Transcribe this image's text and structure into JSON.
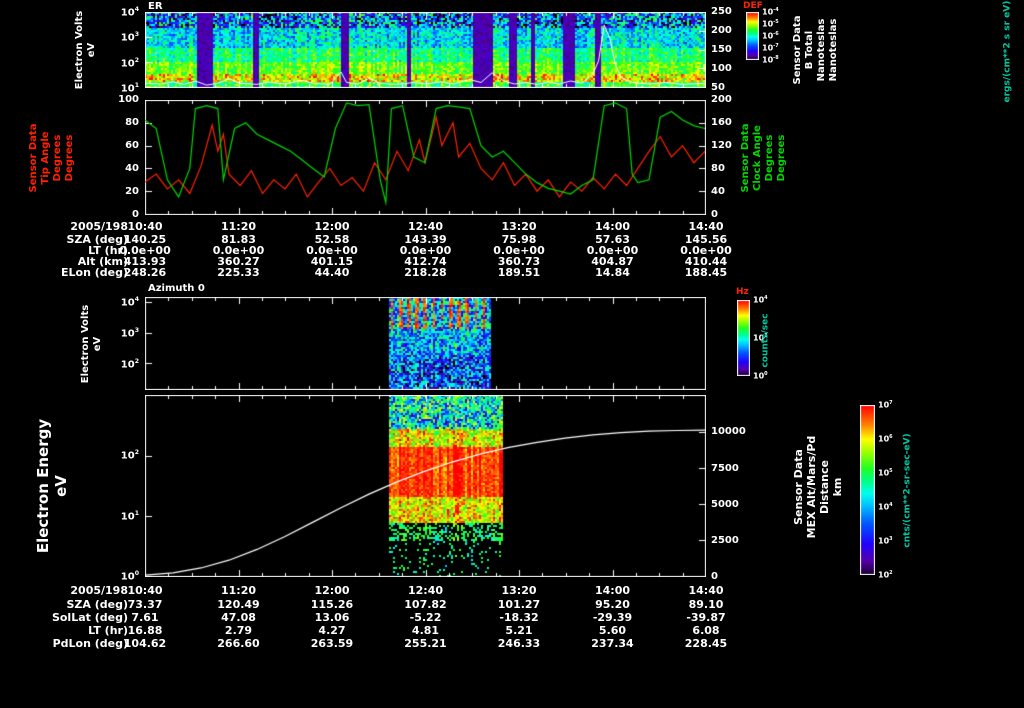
{
  "figure": {
    "background": "#000000"
  },
  "colors": {
    "white": "#ffffff",
    "red": "#ff2200",
    "green": "#00d800",
    "teal": "#00c8a0",
    "background": "#000000"
  },
  "colormap": [
    [
      0.0,
      "#1a0033"
    ],
    [
      0.08,
      "#5500aa"
    ],
    [
      0.18,
      "#2200ff"
    ],
    [
      0.3,
      "#0055ff"
    ],
    [
      0.4,
      "#00bbff"
    ],
    [
      0.48,
      "#00ffee"
    ],
    [
      0.55,
      "#00ff88"
    ],
    [
      0.63,
      "#22ff22"
    ],
    [
      0.72,
      "#99ff00"
    ],
    [
      0.8,
      "#ffff00"
    ],
    [
      0.88,
      "#ff8800"
    ],
    [
      1.0,
      "#ff0000"
    ]
  ],
  "time_axis": {
    "date": "2005/198",
    "ticks": [
      "10:40",
      "11:20",
      "12:00",
      "12:40",
      "13:20",
      "14:00",
      "14:40"
    ]
  },
  "chart_data": [
    {
      "id": "panel1",
      "type": "heatmap",
      "title": "ER",
      "ylabel_lines": [
        "Electron Volts",
        "eV"
      ],
      "yticks": [
        "10^4",
        "10^3",
        "10^2",
        "10^1"
      ],
      "y_range_log": [
        "10^1",
        "10^4"
      ],
      "x_range": [
        "10:40",
        "14:40"
      ],
      "right_axis": {
        "label_lines": [
          "Sensor Data",
          "B Total",
          "Nanoteslas",
          "Nanoteslas"
        ],
        "ticks": [
          "250",
          "200",
          "150",
          "100",
          "50"
        ],
        "range": [
          50,
          250
        ]
      },
      "colorbar": {
        "title": "DEF",
        "ticks": [
          "10^-4",
          "10^-5",
          "10^-6",
          "10^-7",
          "10^-8"
        ],
        "unit": "ergs/(cm**2 s sr eV)"
      },
      "white_line": {
        "axis": "right",
        "x": [
          0,
          0.03,
          0.05,
          0.07,
          0.09,
          0.11,
          0.13,
          0.15,
          0.17,
          0.2,
          0.22,
          0.25,
          0.28,
          0.3,
          0.33,
          0.35,
          0.36,
          0.38,
          0.4,
          0.42,
          0.45,
          0.48,
          0.5,
          0.53,
          0.55,
          0.58,
          0.6,
          0.62,
          0.64,
          0.66,
          0.68,
          0.7,
          0.72,
          0.74,
          0.76,
          0.78,
          0.8,
          0.81,
          0.82,
          0.83,
          0.84,
          0.85,
          0.87,
          0.9,
          0.93,
          0.96,
          1.0
        ],
        "y": [
          60,
          58,
          64,
          57,
          66,
          55,
          60,
          72,
          60,
          57,
          63,
          58,
          68,
          60,
          57,
          90,
          62,
          58,
          73,
          60,
          57,
          62,
          58,
          64,
          58,
          70,
          62,
          88,
          66,
          58,
          62,
          57,
          63,
          58,
          66,
          60,
          85,
          120,
          215,
          180,
          110,
          75,
          62,
          58,
          62,
          57,
          60
        ]
      },
      "texture": {
        "extent": [
          0,
          1
        ],
        "bands": [
          {
            "from": 0.0,
            "to": 0.2,
            "level": 0.3,
            "noise": 0.35
          },
          {
            "from": 0.2,
            "to": 0.45,
            "level": 0.45,
            "noise": 0.15
          },
          {
            "from": 0.45,
            "to": 0.65,
            "level": 0.57,
            "noise": 0.12
          },
          {
            "from": 0.65,
            "to": 0.8,
            "level": 0.68,
            "noise": 0.1
          },
          {
            "from": 0.8,
            "to": 0.9,
            "level": 0.8,
            "noise": 0.16
          },
          {
            "from": 0.9,
            "to": 1.01,
            "level": 0.62,
            "noise": 0.12
          }
        ],
        "streaks": [
          {
            "x": 0.105,
            "w": 0.03
          },
          {
            "x": 0.195,
            "w": 0.01
          },
          {
            "x": 0.355,
            "w": 0.014
          },
          {
            "x": 0.47,
            "w": 0.008
          },
          {
            "x": 0.6,
            "w": 0.034
          },
          {
            "x": 0.655,
            "w": 0.014
          },
          {
            "x": 0.69,
            "w": 0.01
          },
          {
            "x": 0.755,
            "w": 0.022
          },
          {
            "x": 0.806,
            "w": 0.01
          }
        ]
      }
    },
    {
      "id": "panel2",
      "type": "line",
      "x_range": [
        "10:40",
        "14:40"
      ],
      "left_axis": {
        "label_lines": [
          "Sensor Data",
          "Tip Angle",
          "Degrees",
          "Degrees"
        ],
        "ticks": [
          "100",
          "80",
          "60",
          "40",
          "20",
          "0"
        ],
        "range": [
          0,
          100
        ]
      },
      "right_axis": {
        "label_lines": [
          "Sensor Data",
          "Clock Angle",
          "Degrees",
          "Degrees"
        ],
        "ticks": [
          "200",
          "160",
          "120",
          "80",
          "40",
          "0"
        ],
        "range": [
          0,
          200
        ]
      },
      "series": [
        {
          "name": "tip_angle",
          "axis": "left",
          "x": [
            0,
            0.02,
            0.04,
            0.06,
            0.08,
            0.1,
            0.12,
            0.13,
            0.14,
            0.15,
            0.17,
            0.19,
            0.21,
            0.23,
            0.25,
            0.27,
            0.29,
            0.31,
            0.33,
            0.35,
            0.37,
            0.39,
            0.41,
            0.43,
            0.45,
            0.47,
            0.49,
            0.5,
            0.52,
            0.53,
            0.55,
            0.56,
            0.58,
            0.6,
            0.62,
            0.64,
            0.66,
            0.68,
            0.7,
            0.72,
            0.74,
            0.76,
            0.78,
            0.8,
            0.82,
            0.84,
            0.86,
            0.88,
            0.9,
            0.92,
            0.94,
            0.96,
            0.98,
            1.0
          ],
          "y": [
            28,
            35,
            22,
            30,
            18,
            42,
            78,
            55,
            70,
            35,
            25,
            38,
            18,
            30,
            22,
            35,
            15,
            28,
            40,
            25,
            32,
            20,
            45,
            30,
            55,
            38,
            65,
            45,
            85,
            60,
            80,
            50,
            62,
            40,
            30,
            45,
            25,
            35,
            20,
            30,
            15,
            28,
            20,
            32,
            22,
            35,
            25,
            40,
            55,
            68,
            50,
            60,
            45,
            55
          ]
        },
        {
          "name": "clock_angle",
          "axis": "right",
          "x": [
            0,
            0.02,
            0.04,
            0.06,
            0.08,
            0.09,
            0.11,
            0.13,
            0.14,
            0.16,
            0.18,
            0.2,
            0.22,
            0.24,
            0.26,
            0.28,
            0.3,
            0.32,
            0.34,
            0.36,
            0.38,
            0.4,
            0.42,
            0.43,
            0.44,
            0.46,
            0.48,
            0.5,
            0.52,
            0.54,
            0.56,
            0.58,
            0.6,
            0.62,
            0.64,
            0.66,
            0.68,
            0.7,
            0.72,
            0.74,
            0.76,
            0.78,
            0.8,
            0.82,
            0.84,
            0.86,
            0.87,
            0.88,
            0.9,
            0.92,
            0.94,
            0.96,
            0.98,
            1.0
          ],
          "y": [
            165,
            150,
            60,
            30,
            80,
            185,
            190,
            185,
            60,
            150,
            160,
            140,
            130,
            120,
            110,
            95,
            80,
            65,
            150,
            195,
            190,
            192,
            60,
            20,
            185,
            190,
            100,
            90,
            185,
            190,
            188,
            185,
            120,
            100,
            110,
            90,
            70,
            55,
            45,
            40,
            35,
            50,
            60,
            190,
            195,
            185,
            70,
            55,
            60,
            170,
            180,
            165,
            155,
            150
          ]
        }
      ]
    },
    {
      "id": "panel3",
      "type": "heatmap",
      "title": "Azimuth 0",
      "ylabel_lines": [
        "Electron Volts",
        "eV"
      ],
      "yticks": [
        "10^4",
        "10^3",
        "10^2"
      ],
      "x_range": [
        "10:40",
        "14:40"
      ],
      "colorbar": {
        "title": "Hz",
        "ticks": [
          "10^4",
          "10^2",
          "10^0"
        ],
        "unit": "counts/sec"
      },
      "texture": {
        "extent": [
          0.435,
          0.615
        ],
        "bands": [
          {
            "from": 0.0,
            "to": 0.33,
            "level": 0.42,
            "noise": 0.28,
            "burst": true,
            "burstFreq": 0.75
          },
          {
            "from": 0.33,
            "to": 0.62,
            "level": 0.4,
            "noise": 0.24
          },
          {
            "from": 0.62,
            "to": 1.01,
            "level": 0.3,
            "noise": 0.28
          }
        ],
        "streaks": []
      }
    },
    {
      "id": "panel4",
      "type": "heatmap",
      "ylabel_lines": [
        "Electron Energy",
        "eV"
      ],
      "yticks": [
        "10^2",
        "10^1",
        "10^0"
      ],
      "y_range_log": [
        "10^0",
        "10^3"
      ],
      "x_range": [
        "10:40",
        "14:40"
      ],
      "right_axis": {
        "label_lines": [
          "Sensor Data",
          "MEX Alt/Mars/Pd",
          "Distance",
          "km"
        ],
        "ticks": [
          "10000",
          "7500",
          "5000",
          "2500",
          "0"
        ],
        "range": [
          0,
          12600
        ]
      },
      "colorbar": {
        "title": "",
        "ticks": [
          "10^7",
          "10^6",
          "10^5",
          "10^4",
          "10^3",
          "10^2"
        ],
        "unit": "cnts/(cm**2-sr-sec-eV)"
      },
      "white_line": {
        "axis": "right",
        "x": [
          0,
          0.05,
          0.1,
          0.15,
          0.2,
          0.25,
          0.3,
          0.35,
          0.4,
          0.45,
          0.5,
          0.55,
          0.6,
          0.65,
          0.7,
          0.75,
          0.8,
          0.85,
          0.9,
          0.95,
          1.0
        ],
        "y": [
          60,
          220,
          560,
          1100,
          1850,
          2750,
          3750,
          4750,
          5700,
          6550,
          7300,
          7950,
          8500,
          8950,
          9300,
          9600,
          9820,
          9980,
          10080,
          10130,
          10150
        ]
      },
      "texture": {
        "extent": [
          0.435,
          0.635
        ],
        "bands": [
          {
            "from": 0.0,
            "to": 0.08,
            "level": 0.5,
            "noise": 0.3
          },
          {
            "from": 0.08,
            "to": 0.18,
            "level": 0.45,
            "noise": 0.33
          },
          {
            "from": 0.18,
            "to": 0.28,
            "level": 0.78,
            "noise": 0.18
          },
          {
            "from": 0.28,
            "to": 0.55,
            "level": 0.95,
            "noise": 0.07
          },
          {
            "from": 0.55,
            "to": 0.7,
            "level": 0.8,
            "noise": 0.16
          },
          {
            "from": 0.7,
            "to": 0.8,
            "level": 0.58,
            "noise": 0.1,
            "density": 0.45
          },
          {
            "from": 0.8,
            "to": 1.01,
            "level": 0.55,
            "noise": 0.08,
            "density": 0.1
          }
        ],
        "streaks": []
      }
    }
  ],
  "upper_annotations": {
    "rows": [
      {
        "label": "2005/198",
        "values": [
          "10:40",
          "11:20",
          "12:00",
          "12:40",
          "13:20",
          "14:00",
          "14:40"
        ]
      },
      {
        "label": "SZA (deg)",
        "values": [
          "140.25",
          "81.83",
          "52.58",
          "143.39",
          "75.98",
          "57.63",
          "145.56"
        ]
      },
      {
        "label": "LT (hr)",
        "values": [
          "0.0e+00",
          "0.0e+00",
          "0.0e+00",
          "0.0e+00",
          "0.0e+00",
          "0.0e+00",
          "0.0e+00"
        ]
      },
      {
        "label": "Alt (km)",
        "values": [
          "413.93",
          "360.27",
          "401.15",
          "412.74",
          "360.73",
          "404.87",
          "410.44"
        ]
      },
      {
        "label": "ELon (deg)",
        "values": [
          "248.26",
          "225.33",
          "44.40",
          "218.28",
          "189.51",
          "14.84",
          "188.45"
        ]
      }
    ]
  },
  "lower_annotations": {
    "rows": [
      {
        "label": "2005/198",
        "values": [
          "10:40",
          "11:20",
          "12:00",
          "12:40",
          "13:20",
          "14:00",
          "14:40"
        ]
      },
      {
        "label": "SZA (deg)",
        "values": [
          "73.37",
          "120.49",
          "115.26",
          "107.82",
          "101.27",
          "95.20",
          "89.10"
        ]
      },
      {
        "label": "SolLat (deg)",
        "values": [
          "7.61",
          "47.08",
          "13.06",
          "-5.22",
          "-18.32",
          "-29.39",
          "-39.87"
        ]
      },
      {
        "label": "LT (hr)",
        "values": [
          "16.88",
          "2.79",
          "4.27",
          "4.81",
          "5.21",
          "5.60",
          "6.08"
        ]
      },
      {
        "label": "PdLon (deg)",
        "values": [
          "104.62",
          "266.60",
          "263.59",
          "255.21",
          "246.33",
          "237.34",
          "228.45"
        ]
      }
    ]
  }
}
